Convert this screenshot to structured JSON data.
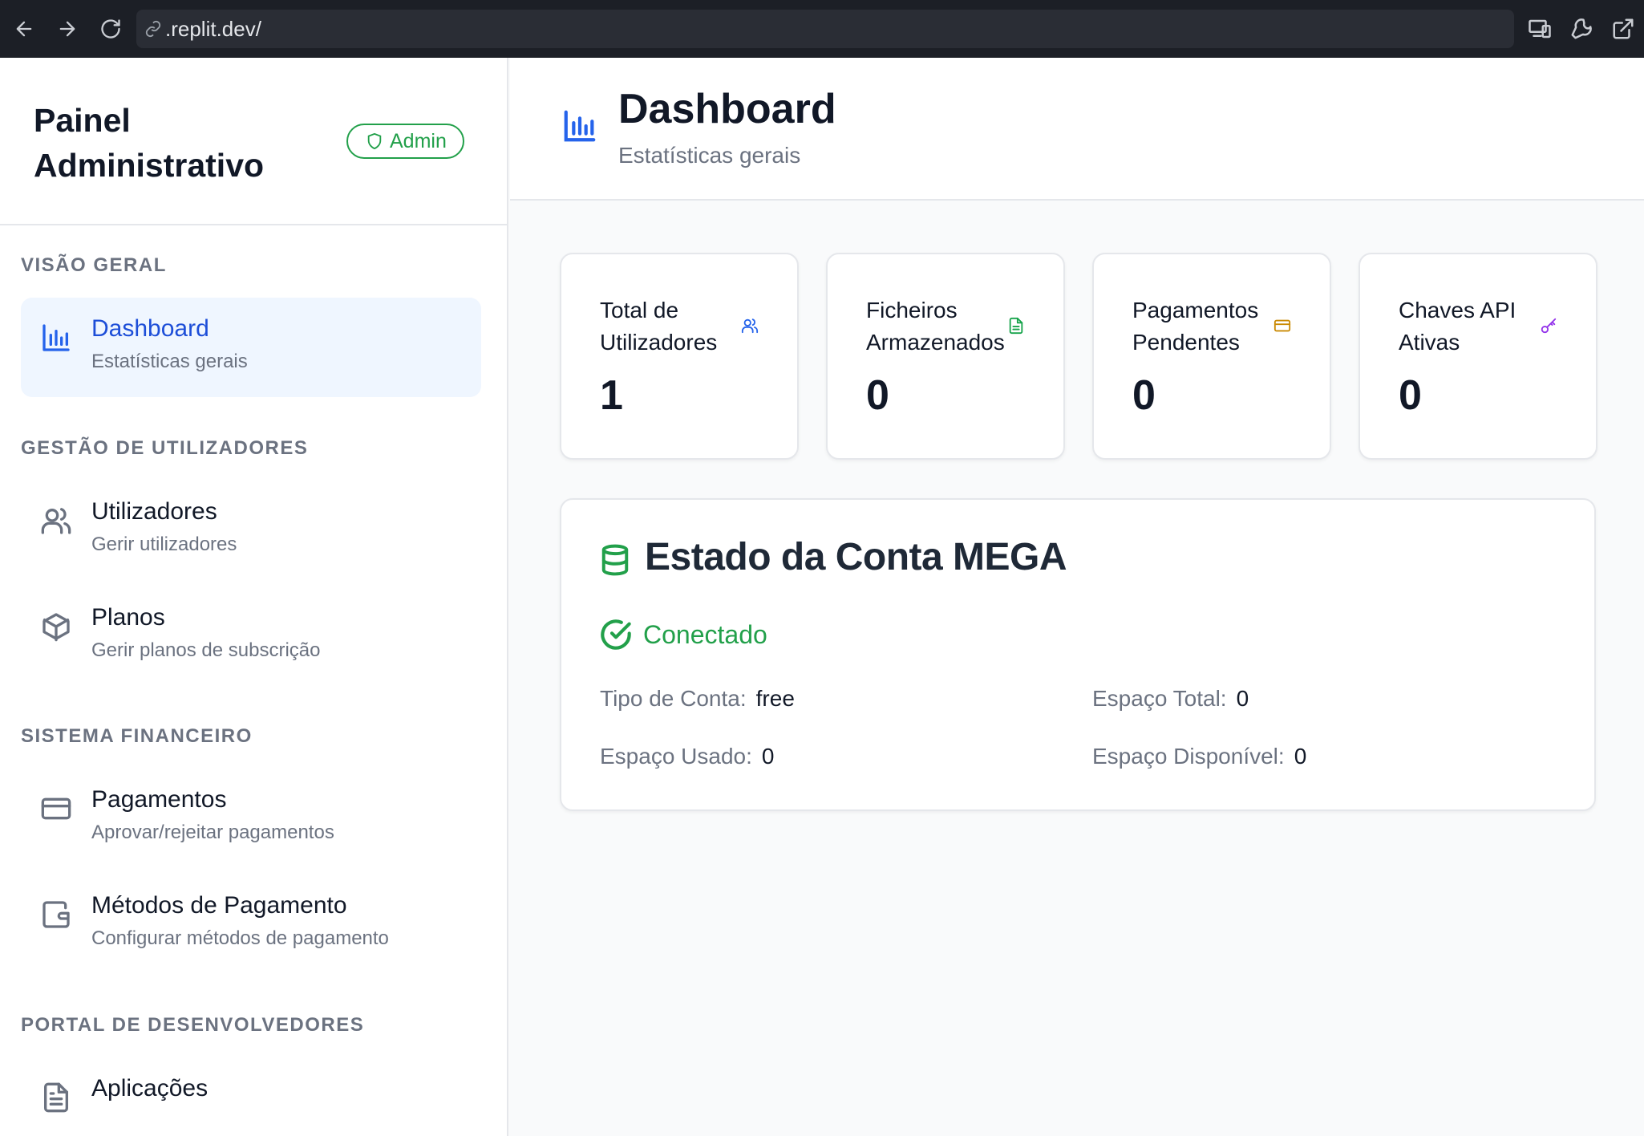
{
  "browser": {
    "url": ".replit.dev/"
  },
  "sidebar": {
    "title": "Painel Administrativo",
    "badge": "Admin",
    "sections": [
      {
        "label": "VISÃO GERAL",
        "items": [
          {
            "label": "Dashboard",
            "sub": "Estatísticas gerais",
            "icon": "bar-chart-icon",
            "active": true
          }
        ]
      },
      {
        "label": "GESTÃO DE UTILIZADORES",
        "items": [
          {
            "label": "Utilizadores",
            "sub": "Gerir utilizadores",
            "icon": "users-icon"
          },
          {
            "label": "Planos",
            "sub": "Gerir planos de subscrição",
            "icon": "package-icon"
          }
        ]
      },
      {
        "label": "SISTEMA FINANCEIRO",
        "items": [
          {
            "label": "Pagamentos",
            "sub": "Aprovar/rejeitar pagamentos",
            "icon": "credit-card-icon"
          },
          {
            "label": "Métodos de Pagamento",
            "sub": "Configurar métodos de pagamento",
            "icon": "wallet-icon"
          }
        ]
      },
      {
        "label": "PORTAL DE DESENVOLVEDORES",
        "items": [
          {
            "label": "Aplicações",
            "sub": "",
            "icon": "file-text-icon"
          }
        ]
      }
    ]
  },
  "header": {
    "title": "Dashboard",
    "subtitle": "Estatísticas gerais"
  },
  "stats": [
    {
      "label": "Total de Utilizadores",
      "value": "1",
      "icon": "users-icon",
      "color": "#2563eb"
    },
    {
      "label": "Ficheiros Armazenados",
      "value": "0",
      "icon": "file-icon",
      "color": "#16a34a"
    },
    {
      "label": "Pagamentos Pendentes",
      "value": "0",
      "icon": "credit-card-icon",
      "color": "#ca8a04"
    },
    {
      "label": "Chaves API Ativas",
      "value": "0",
      "icon": "key-icon",
      "color": "#9333ea"
    }
  ],
  "mega": {
    "title": "Estado da Conta MEGA",
    "status": "Conectado",
    "status_color": "#22a04a",
    "account_type_label": "Tipo de Conta:",
    "account_type": "free",
    "space_total_label": "Espaço Total:",
    "space_total": "0",
    "space_used_label": "Espaço Usado:",
    "space_used": "0",
    "space_available_label": "Espaço Disponível:",
    "space_available": "0"
  }
}
